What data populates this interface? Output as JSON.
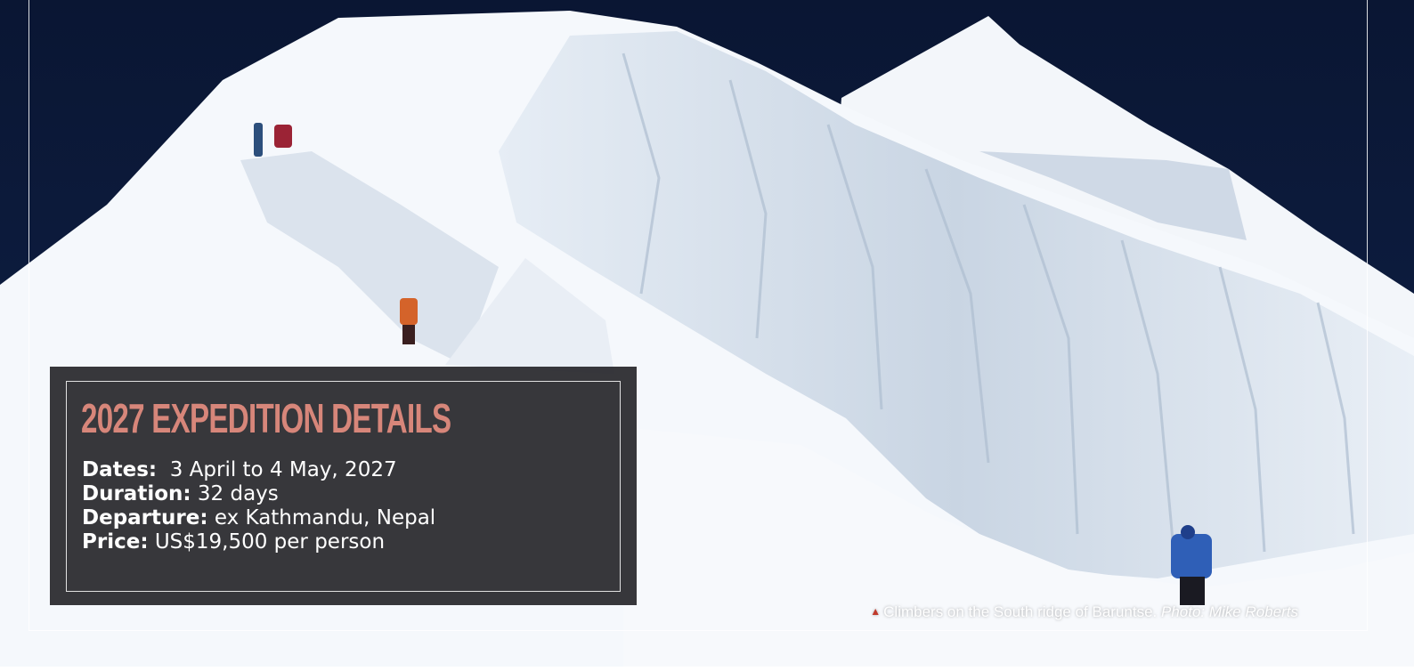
{
  "photo": {
    "subject": "Snow and ice ridge of Baruntse with climbers",
    "colors": {
      "sky": "#0c1a3a",
      "snow": "#f4f7fb",
      "shadow": "#c7d2e0",
      "panel": "#2d2d30",
      "title": "#d7867a",
      "marker": "#c0392b"
    }
  },
  "panel": {
    "title": "2027 EXPEDITION DETAILS",
    "details": [
      {
        "key": "Dates:",
        "value": "  3 April to 4 May, 2027"
      },
      {
        "key": "Duration:",
        "value": " 32 days"
      },
      {
        "key": "Departure:",
        "value": " ex Kathmandu, Nepal"
      },
      {
        "key": "Price:",
        "value": " US$19,500 per person"
      }
    ]
  },
  "caption": {
    "marker_icon": "triangle-up-icon",
    "text": "Climbers on the South ridge of Baruntse. ",
    "credit": "Photo: Mike Roberts"
  }
}
